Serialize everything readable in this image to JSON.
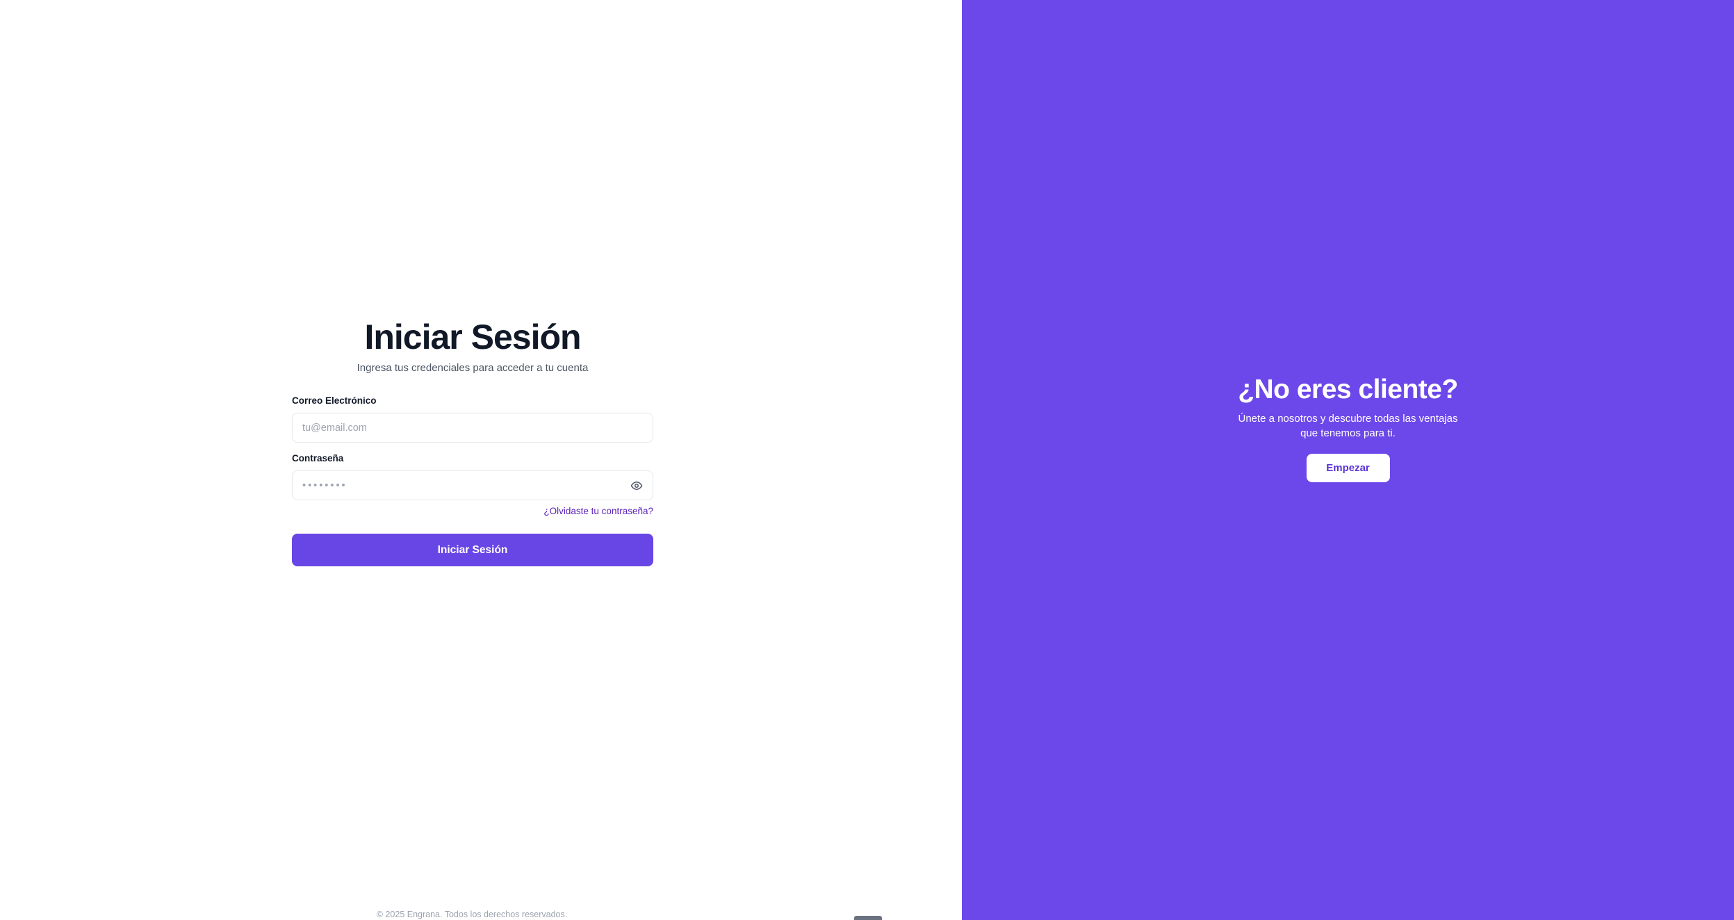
{
  "login": {
    "title": "Iniciar Sesión",
    "subtitle": "Ingresa tus credenciales para acceder a tu cuenta",
    "email": {
      "label": "Correo Electrónico",
      "placeholder": "tu@email.com",
      "value": ""
    },
    "password": {
      "label": "Contraseña",
      "placeholder": "••••••••",
      "value": "",
      "toggle_icon": "eye-icon"
    },
    "forgot_link": "¿Olvidaste tu contraseña?",
    "submit_label": "Iniciar Sesión"
  },
  "footer": {
    "copyright": "© 2025 Engrana. Todos los derechos reservados."
  },
  "promo": {
    "title": "¿No eres cliente?",
    "text_line1": "Únete a nosotros y descubre todas las ventajas",
    "text_line2": "que tenemos para ti.",
    "button_label": "Empezar"
  },
  "colors": {
    "accent": "#6846e5",
    "promo_background": "#6c48ea",
    "link": "#5b21b6",
    "title_text": "#111827"
  }
}
